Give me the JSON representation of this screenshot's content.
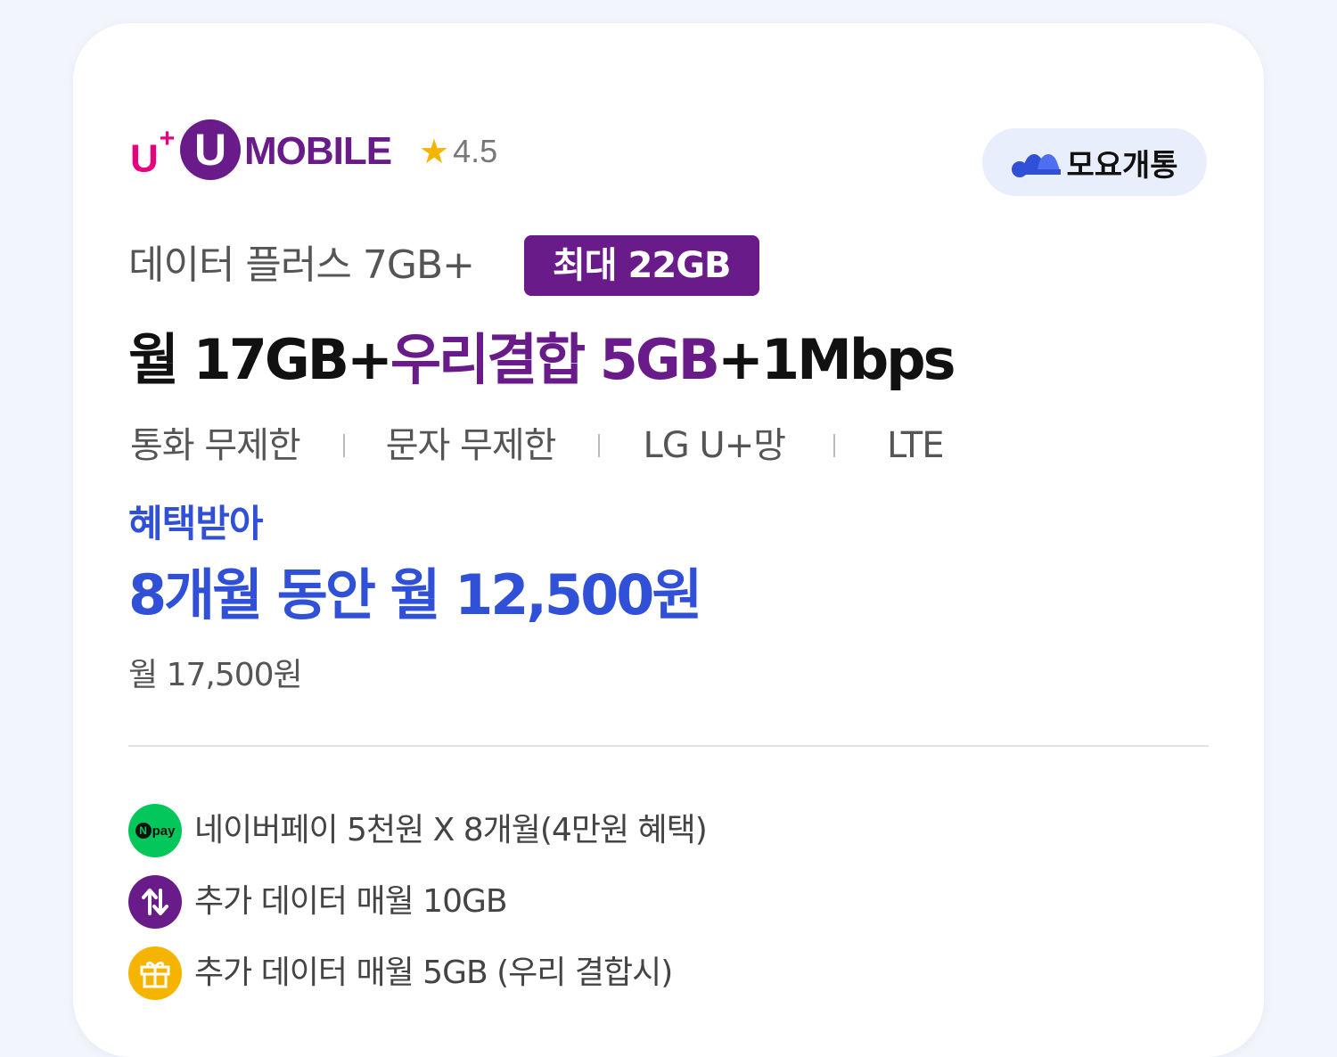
{
  "brand": {
    "logo_uplus": "U",
    "logo_plus": "+",
    "logo_u": "U",
    "logo_mobile": "MOBILE",
    "rating_icon": "star-icon",
    "rating": "4.5"
  },
  "badge": {
    "icon": "moyo-logo-icon",
    "label": "모요개통"
  },
  "plan": {
    "name": "데이터 플러스 7GB+",
    "max_badge": "최대 22GB",
    "headline_part1": "월 17GB+",
    "headline_part2": "우리결합 5GB",
    "headline_part3": "+1Mbps",
    "features": [
      "통화 무제한",
      "문자 무제한",
      "LG U+망",
      "LTE"
    ]
  },
  "price": {
    "benefit_label": "혜택받아",
    "benefit_price": "8개월 동안 월 12,500원",
    "original_price": "월 17,500원"
  },
  "perks": [
    {
      "icon": "naver-pay-icon",
      "icon_n": "N",
      "icon_pay": "pay",
      "text": "네이버페이 5천원 X 8개월(4만원 혜택)"
    },
    {
      "icon": "data-transfer-icon",
      "text": "추가 데이터 매월 10GB"
    },
    {
      "icon": "gift-icon",
      "text": "추가 데이터 매월 5GB (우리 결합시)"
    }
  ],
  "colors": {
    "brand_purple": "#6a1b8a",
    "brand_magenta": "#e6007e",
    "accent_blue": "#3050d8",
    "npay_green": "#03c75a",
    "gift_yellow": "#f5b400",
    "badge_bg": "#e9eefd"
  }
}
